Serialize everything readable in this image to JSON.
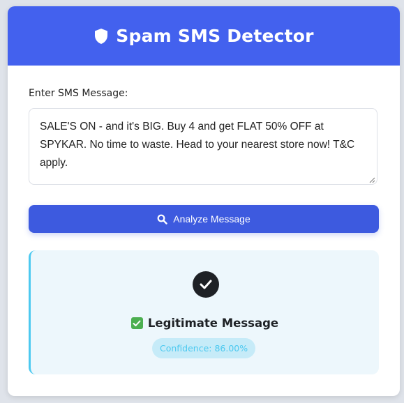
{
  "header": {
    "title": "Spam SMS Detector",
    "icon": "shield-icon"
  },
  "form": {
    "label": "Enter SMS Message:",
    "message": "SALE'S ON - and it's BIG. Buy 4 and get FLAT 50% OFF at SPYKAR. No time to waste. Head to your nearest store now! T&C apply."
  },
  "button": {
    "label": "Analyze Message",
    "icon": "search-icon"
  },
  "result": {
    "icon": "check-circle-icon",
    "verdict": "Legitimate Message",
    "confidence_label": "Confidence: 86.00%",
    "confidence_value": 0.86
  },
  "colors": {
    "primary": "#4361ee",
    "button": "#3d5adf",
    "accent": "#4cc9f0",
    "result_bg": "#edf7fc",
    "success": "#4caf50"
  }
}
